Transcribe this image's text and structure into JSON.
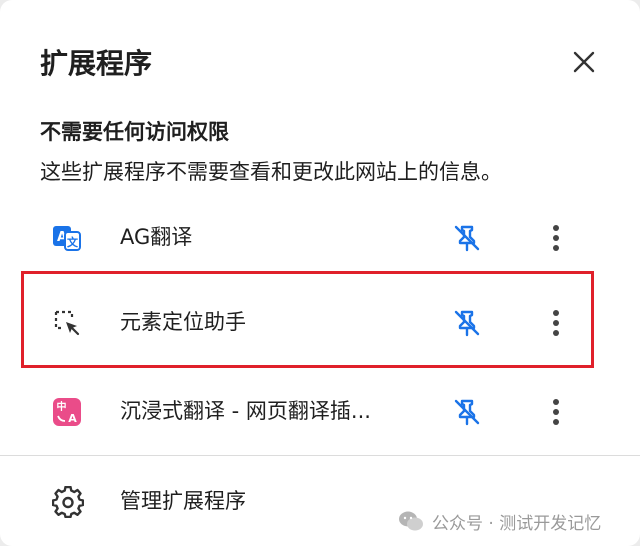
{
  "header": {
    "title": "扩展程序",
    "close_icon": "close-icon"
  },
  "section": {
    "heading": "不需要任何访问权限",
    "description": "这些扩展程序不需要查看和更改此网站上的信息。"
  },
  "extensions": [
    {
      "name": "AG翻译",
      "icon": "translate-ag-icon",
      "pinned": false
    },
    {
      "name": "元素定位助手",
      "icon": "element-locator-icon",
      "pinned": false
    },
    {
      "name": "沉浸式翻译 - 网页翻译插...",
      "icon": "immersive-translate-icon",
      "pinned": false
    }
  ],
  "manage": {
    "label": "管理扩展程序",
    "icon": "gear-icon"
  },
  "watermark": {
    "text": "公众号 · 测试开发记忆"
  },
  "colors": {
    "accent": "#1a73e8",
    "highlight": "#e0202a",
    "immersive_brand": "#ea4c89",
    "text": "#1f1f1f"
  }
}
